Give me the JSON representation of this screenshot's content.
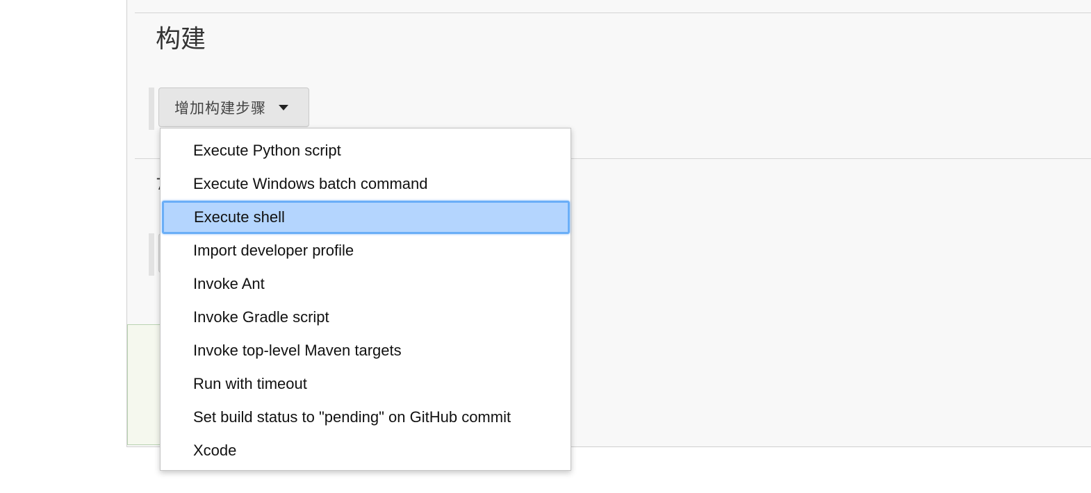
{
  "section": {
    "title": "构建",
    "post_build_hint_char": "7"
  },
  "add_step_button": {
    "label": "增加构建步骤"
  },
  "dropdown": {
    "items": [
      "Execute Python script",
      "Execute Windows batch command",
      "Execute shell",
      "Import developer profile",
      "Invoke Ant",
      "Invoke Gradle script",
      "Invoke top-level Maven targets",
      "Run with timeout",
      "Set build status to \"pending\" on GitHub commit",
      "Xcode"
    ],
    "selected_index": 2,
    "selected_color": "#b4d5fe"
  }
}
